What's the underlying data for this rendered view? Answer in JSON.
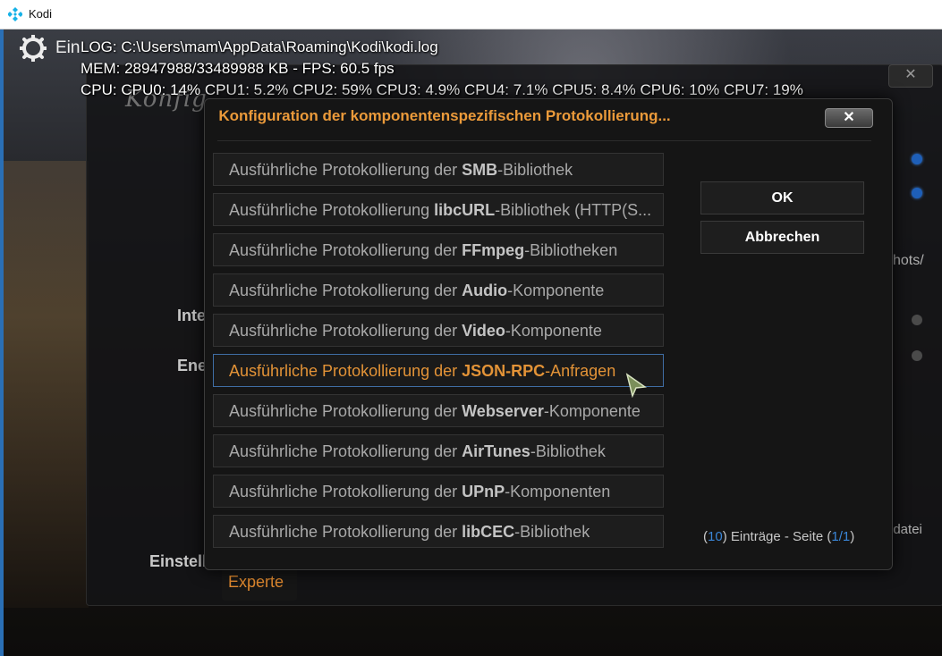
{
  "window": {
    "title": "Kodi"
  },
  "background": {
    "breadcrumb": "Ein",
    "panel_title": "Konfig",
    "rows": [
      {
        "label": "Inte"
      },
      {
        "label": "Ene"
      }
    ],
    "right_fragments": [
      "hots/",
      "gdatei"
    ],
    "footer_label": "Einstellungsebene",
    "footer_value": "Experte",
    "close_label": "✕"
  },
  "debug": {
    "log": "LOG: C:\\Users\\mam\\AppData\\Roaming\\Kodi\\kodi.log",
    "mem": "MEM: 28947988/33489988 KB - FPS: 60.5 fps",
    "cpu": "CPU: CPU0:  14% CPU1: 5.2% CPU2:  59% CPU3: 4.9% CPU4: 7.1% CPU5: 8.4% CPU6:  10% CPU7:  19%"
  },
  "dialog": {
    "title": "Konfiguration der komponentenspezifischen Protokollierung...",
    "close_label": "✕",
    "items": [
      {
        "pre": "Ausführliche Protokollierung der ",
        "bold": "SMB",
        "post": "-Bibliothek",
        "selected": false
      },
      {
        "pre": "Ausführliche Protokollierung ",
        "bold": "libcURL",
        "post": "-Bibliothek (HTTP(S...",
        "selected": false
      },
      {
        "pre": "Ausführliche Protokollierung der ",
        "bold": "FFmpeg",
        "post": "-Bibliotheken",
        "selected": false
      },
      {
        "pre": "Ausführliche Protokollierung der ",
        "bold": "Audio",
        "post": "-Komponente",
        "selected": false
      },
      {
        "pre": "Ausführliche Protokollierung der ",
        "bold": "Video",
        "post": "-Komponente",
        "selected": false
      },
      {
        "pre": "Ausführliche Protokollierung der ",
        "bold": "JSON-RPC",
        "post": "-Anfragen",
        "selected": true
      },
      {
        "pre": "Ausführliche Protokollierung der ",
        "bold": "Webserver",
        "post": "-Komponente",
        "selected": false
      },
      {
        "pre": "Ausführliche Protokollierung der ",
        "bold": "AirTunes",
        "post": "-Bibliothek",
        "selected": false
      },
      {
        "pre": "Ausführliche Protokollierung der ",
        "bold": "UPnP",
        "post": "-Komponenten",
        "selected": false
      },
      {
        "pre": "Ausführliche Protokollierung der ",
        "bold": "libCEC",
        "post": "-Bibliothek",
        "selected": false
      }
    ],
    "ok_label": "OK",
    "cancel_label": "Abbrechen",
    "paging": {
      "open_paren": "(",
      "count": "10",
      "middle": ") Einträge - Seite (",
      "page": "1/1",
      "close_paren": ")"
    }
  },
  "colors": {
    "accent_orange": "#eb9a3a",
    "focus_blue": "#3f6da4",
    "number_blue": "#3a86d8"
  },
  "icons": {
    "app_logo": "kodi-logo-icon",
    "settings": "gear-icon",
    "pointer": "mouse-pointer-icon"
  }
}
